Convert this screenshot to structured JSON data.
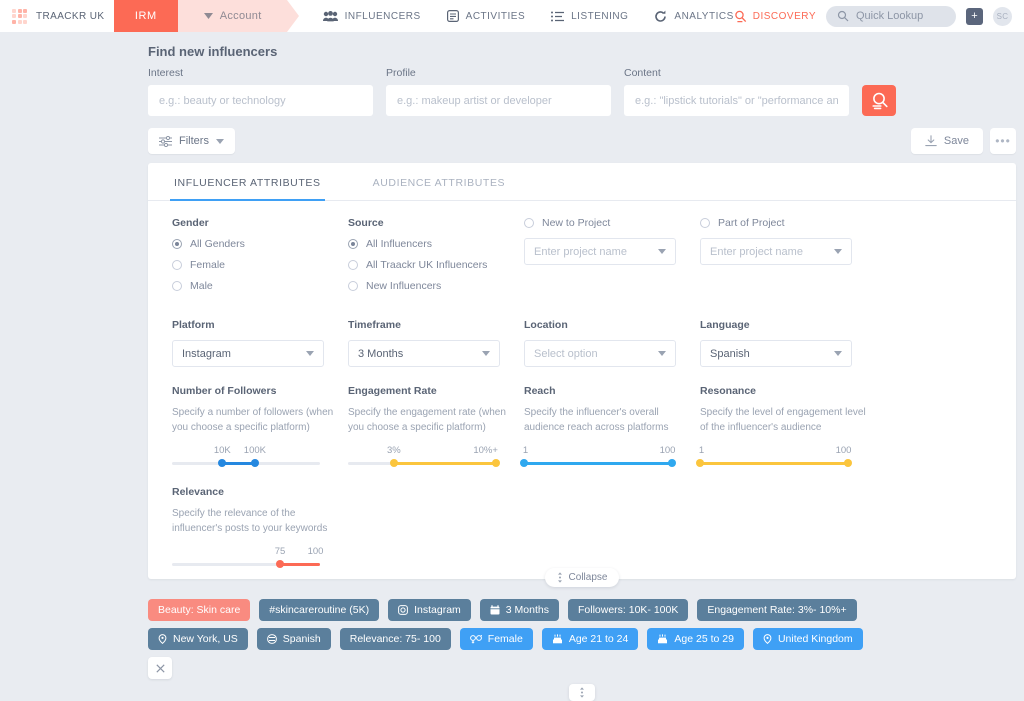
{
  "topnav": {
    "brand": "TRAACKR UK",
    "irm_tab": "IRM",
    "account_tab": "Account",
    "nav_items": [
      {
        "label": "INFLUENCERS",
        "icon": "people-icon"
      },
      {
        "label": "ACTIVITIES",
        "icon": "document-icon"
      },
      {
        "label": "LISTENING",
        "icon": "list-icon"
      },
      {
        "label": "ANALYTICS",
        "icon": "refresh-icon"
      }
    ],
    "discovery": "DISCOVERY",
    "quick_lookup": "Quick Lookup",
    "add_button": "+",
    "avatar_initials": "SC"
  },
  "page": {
    "title": "Find new influencers"
  },
  "search": {
    "interest": {
      "label": "Interest",
      "placeholder": "e.g.: beauty or technology",
      "value": ""
    },
    "profile": {
      "label": "Profile",
      "placeholder": "e.g.: makeup artist or developer",
      "value": ""
    },
    "content": {
      "label": "Content",
      "placeholder": "e.g.: \"lipstick tutorials\" or \"performance analysis\"",
      "value": ""
    },
    "search_button": "search-icon"
  },
  "toolbar": {
    "filters_label": "Filters",
    "save_label": "Save",
    "more_label": "•••"
  },
  "tabs": [
    {
      "label": "INFLUENCER ATTRIBUTES",
      "active": true
    },
    {
      "label": "AUDIENCE ATTRIBUTES",
      "active": false
    }
  ],
  "filters": {
    "gender": {
      "title": "Gender",
      "options": [
        {
          "label": "All Genders",
          "selected": true
        },
        {
          "label": "Female",
          "selected": false
        },
        {
          "label": "Male",
          "selected": false
        }
      ]
    },
    "source": {
      "title": "Source",
      "options": [
        {
          "label": "All Influencers",
          "selected": true
        },
        {
          "label": "All Traackr UK Influencers",
          "selected": false
        },
        {
          "label": "New Influencers",
          "selected": false
        }
      ]
    },
    "new_to_project": {
      "label": "New to Project",
      "selected": false,
      "select_placeholder": "Enter project name",
      "select_value": ""
    },
    "part_of_project": {
      "label": "Part of Project",
      "selected": false,
      "select_placeholder": "Enter project name",
      "select_value": ""
    },
    "platform": {
      "label": "Platform",
      "value": "Instagram"
    },
    "timeframe": {
      "label": "Timeframe",
      "value": "3 Months"
    },
    "location": {
      "label": "Location",
      "value": "",
      "placeholder": "Select option"
    },
    "language": {
      "label": "Language",
      "value": "Spanish"
    },
    "followers": {
      "title": "Number of Followers",
      "desc": "Specify a number of followers (when you choose a specific platform)",
      "min_label": "10K",
      "max_label": "100K",
      "color": "#2588e0"
    },
    "engagement": {
      "title": "Engagement Rate",
      "desc": "Specify the engagement rate (when you choose a specific platform)",
      "min_label": "3%",
      "max_label": "10%+",
      "color": "#fbc53d"
    },
    "reach": {
      "title": "Reach",
      "desc": "Specify the influencer's overall audience reach across platforms",
      "min_label": "1",
      "max_label": "100",
      "color": "#2fa8ef"
    },
    "resonance": {
      "title": "Resonance",
      "desc": "Specify the level of engagement level of the influencer's audience",
      "min_label": "1",
      "max_label": "100",
      "color": "#fbc53d"
    },
    "relevance": {
      "title": "Relevance",
      "desc": "Specify the relevance of the influencer's posts to your keywords",
      "min_label": "75",
      "max_label": "100",
      "color": "#fc6a55"
    }
  },
  "collapse": {
    "label": "Collapse"
  },
  "chips": [
    {
      "label": "Beauty: Skin care",
      "style": "salmon",
      "icon": ""
    },
    {
      "label": "#skincareroutine (5K)",
      "style": "slate",
      "icon": ""
    },
    {
      "label": "Instagram",
      "style": "slate",
      "icon": "instagram-icon"
    },
    {
      "label": "3 Months",
      "style": "slate",
      "icon": "calendar-icon"
    },
    {
      "label": "Followers: 10K- 100K",
      "style": "slate",
      "icon": ""
    },
    {
      "label": "Engagement Rate: 3%- 10%+",
      "style": "slate",
      "icon": ""
    },
    {
      "label": "New York, US",
      "style": "slate",
      "icon": "pin-icon"
    },
    {
      "label": "Spanish",
      "style": "slate",
      "icon": "language-icon"
    },
    {
      "label": "Relevance: 75- 100",
      "style": "slate",
      "icon": ""
    },
    {
      "label": "Female",
      "style": "blue",
      "icon": "gender-icon"
    },
    {
      "label": "Age 21 to 24",
      "style": "blue",
      "icon": "cake-icon"
    },
    {
      "label": "Age 25 to 29",
      "style": "blue",
      "icon": "cake-icon"
    },
    {
      "label": "United Kingdom",
      "style": "blue",
      "icon": "pin-icon"
    },
    {
      "label": "✕",
      "style": "clear",
      "icon": "close-icon"
    }
  ]
}
